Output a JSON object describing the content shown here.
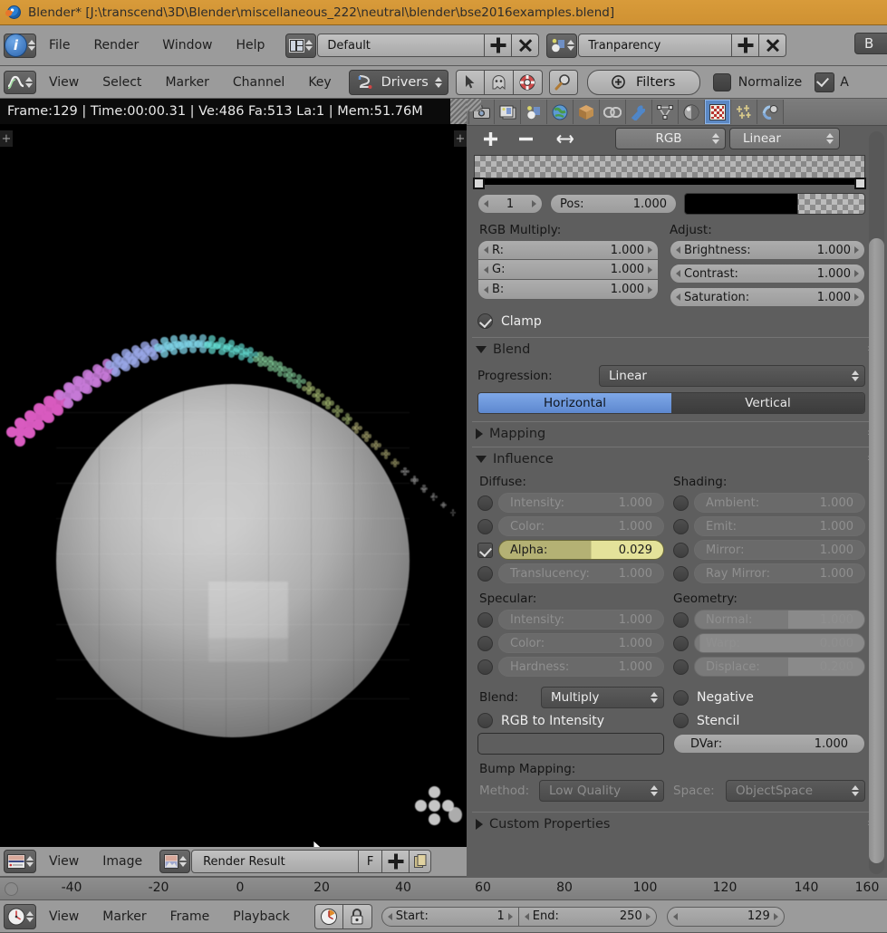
{
  "window": {
    "title": "Blender* [J:\\transcend\\3D\\Blender\\miscellaneous_222\\neutral\\blender\\bse2016examples.blend]",
    "logo_icon": "blender-logo-icon"
  },
  "info_header": {
    "editor_icon": "info-editor-icon",
    "menus": [
      "File",
      "Render",
      "Window",
      "Help"
    ],
    "screen_layout": {
      "icon": "screen-layout-icon",
      "value": "Default",
      "add_icon": "plus-icon",
      "delete_icon": "x-icon"
    },
    "scene": {
      "icon": "scene-icon",
      "value": "Tranparency",
      "add_icon": "plus-icon",
      "delete_icon": "x-icon"
    },
    "engine_cut": "B"
  },
  "drivers_header": {
    "editor_icon": "drivers-editor-icon",
    "menus": [
      "View",
      "Select",
      "Marker",
      "Channel",
      "Key"
    ],
    "mode": {
      "icon": "drivers-icon",
      "value": "Drivers"
    },
    "tools": [
      "cursor-select-icon",
      "ghost-icon",
      "lifebuoy-icon",
      "magnifier-icon"
    ],
    "filters_label": "Filters",
    "filters_icon": "plus-circle-icon",
    "normalize_label": "Normalize",
    "auto_label": "A"
  },
  "info_strip": {
    "text": "Frame:129 | Time:00:00.31 | Ve:486 Fa:513 La:1 | Mem:51.76M"
  },
  "viewport": {
    "region_toggle_left": "+",
    "region_toggle_right": "+",
    "cursor_icon": "mouse-pointer-icon"
  },
  "image_editor_header": {
    "editor_icon": "image-editor-icon",
    "menus": [
      "View",
      "Image"
    ],
    "datablock": {
      "icon": "image-datablock-icon",
      "value": "Render Result"
    },
    "fake_user_label": "F",
    "add_icon": "plus-icon",
    "copy_icon": "copy-icon"
  },
  "image_ruler": {
    "ticks": [
      "-40",
      "-20",
      "0",
      "20",
      "40",
      "60",
      "80",
      "100",
      "120",
      "140",
      "160"
    ]
  },
  "timeline": {
    "editor_icon": "timeline-editor-icon",
    "menus": [
      "View",
      "Marker",
      "Frame",
      "Playback"
    ],
    "auto_key_icon": "record-clock-icon",
    "lock_icon": "lock-icon",
    "start": {
      "label": "Start:",
      "value": "1"
    },
    "end": {
      "label": "End:",
      "value": "250"
    },
    "current_frame": {
      "value": "129"
    }
  },
  "properties": {
    "tabs": [
      {
        "name": "render",
        "icon": "camera-icon",
        "active": false
      },
      {
        "name": "render-layers",
        "icon": "render-layers-icon",
        "active": false
      },
      {
        "name": "scene",
        "icon": "scene-icon",
        "active": false
      },
      {
        "name": "world",
        "icon": "world-icon",
        "active": false
      },
      {
        "name": "object",
        "icon": "cube-icon",
        "active": false
      },
      {
        "name": "constraints",
        "icon": "chain-icon",
        "active": false
      },
      {
        "name": "modifiers",
        "icon": "wrench-icon",
        "active": false
      },
      {
        "name": "data",
        "icon": "mesh-data-icon",
        "active": false
      },
      {
        "name": "material",
        "icon": "material-sphere-icon",
        "active": false
      },
      {
        "name": "texture",
        "icon": "checker-texture-icon",
        "active": true
      },
      {
        "name": "particles",
        "icon": "particles-icon",
        "active": false
      },
      {
        "name": "physics",
        "icon": "physics-icon",
        "active": false
      }
    ],
    "ramp": {
      "add_icon": "plus-icon",
      "remove_icon": "minus-icon",
      "flip_icon": "flip-arrows-icon",
      "interpolation_type": "RGB",
      "interpolation": "Linear",
      "index": "1",
      "pos_label": "Pos:",
      "pos_value": "1.000",
      "color_value": "#000000"
    },
    "rgb_multiply": {
      "title": "RGB Multiply:",
      "fields": [
        {
          "label": "R:",
          "value": "1.000"
        },
        {
          "label": "G:",
          "value": "1.000"
        },
        {
          "label": "B:",
          "value": "1.000"
        }
      ]
    },
    "adjust": {
      "title": "Adjust:",
      "fields": [
        {
          "label": "Brightness:",
          "value": "1.000"
        },
        {
          "label": "Contrast:",
          "value": "1.000"
        },
        {
          "label": "Saturation:",
          "value": "1.000"
        }
      ]
    },
    "clamp": {
      "label": "Clamp",
      "checked": true
    },
    "blend_panel": {
      "title": "Blend",
      "progression_label": "Progression:",
      "progression_value": "Linear",
      "horizontal_label": "Horizontal",
      "vertical_label": "Vertical",
      "active_axis": "Horizontal"
    },
    "mapping_panel": {
      "title": "Mapping",
      "expanded": false
    },
    "influence_panel": {
      "title": "Influence",
      "expanded": true,
      "diffuse": {
        "title": "Diffuse:",
        "rows": [
          {
            "label": "Intensity:",
            "value": "1.000",
            "enabled": false
          },
          {
            "label": "Color:",
            "value": "1.000",
            "enabled": false
          },
          {
            "label": "Alpha:",
            "value": "0.029",
            "enabled": true
          },
          {
            "label": "Translucency:",
            "value": "1.000",
            "enabled": false
          }
        ]
      },
      "shading": {
        "title": "Shading:",
        "rows": [
          {
            "label": "Ambient:",
            "value": "1.000",
            "enabled": false
          },
          {
            "label": "Emit:",
            "value": "1.000",
            "enabled": false
          },
          {
            "label": "Mirror:",
            "value": "1.000",
            "enabled": false
          },
          {
            "label": "Ray Mirror:",
            "value": "1.000",
            "enabled": false
          }
        ]
      },
      "specular": {
        "title": "Specular:",
        "rows": [
          {
            "label": "Intensity:",
            "value": "1.000",
            "enabled": false
          },
          {
            "label": "Color:",
            "value": "1.000",
            "enabled": false
          },
          {
            "label": "Hardness:",
            "value": "1.000",
            "enabled": false
          }
        ]
      },
      "geometry": {
        "title": "Geometry:",
        "rows": [
          {
            "label": "Normal:",
            "value": "1.000",
            "enabled": false,
            "fill": 0.62
          },
          {
            "label": "Warp:",
            "value": "0.000",
            "enabled": false,
            "fill": 0.03
          },
          {
            "label": "Displace:",
            "value": "0.200",
            "enabled": false,
            "fill": 0.6
          }
        ]
      },
      "blend_label": "Blend:",
      "blend_value": "Multiply",
      "negative": {
        "label": "Negative",
        "checked": false
      },
      "rgb_to_intensity": {
        "label": "RGB to Intensity",
        "checked": false
      },
      "stencil": {
        "label": "Stencil",
        "checked": false
      },
      "color_swatch": "#ff00ff",
      "dvar": {
        "label": "DVar:",
        "value": "1.000"
      },
      "bump_mapping": {
        "title": "Bump Mapping:",
        "method_label": "Method:",
        "method_value": "Low Quality",
        "space_label": "Space:",
        "space_value": "ObjectSpace"
      }
    },
    "custom_properties_panel": {
      "title": "Custom Properties",
      "expanded": false
    }
  },
  "render_image": {
    "description": "Rendered grey UV sphere on black background with a rainbow trail of cross-shaped particles",
    "particle_colors": [
      "#d95bc0",
      "#c77ad8",
      "#9aa8e8",
      "#7fd4e8",
      "#66e3d8",
      "#8fe0a8",
      "#c8e08a",
      "#e8e49a",
      "#f0f0f0"
    ]
  }
}
